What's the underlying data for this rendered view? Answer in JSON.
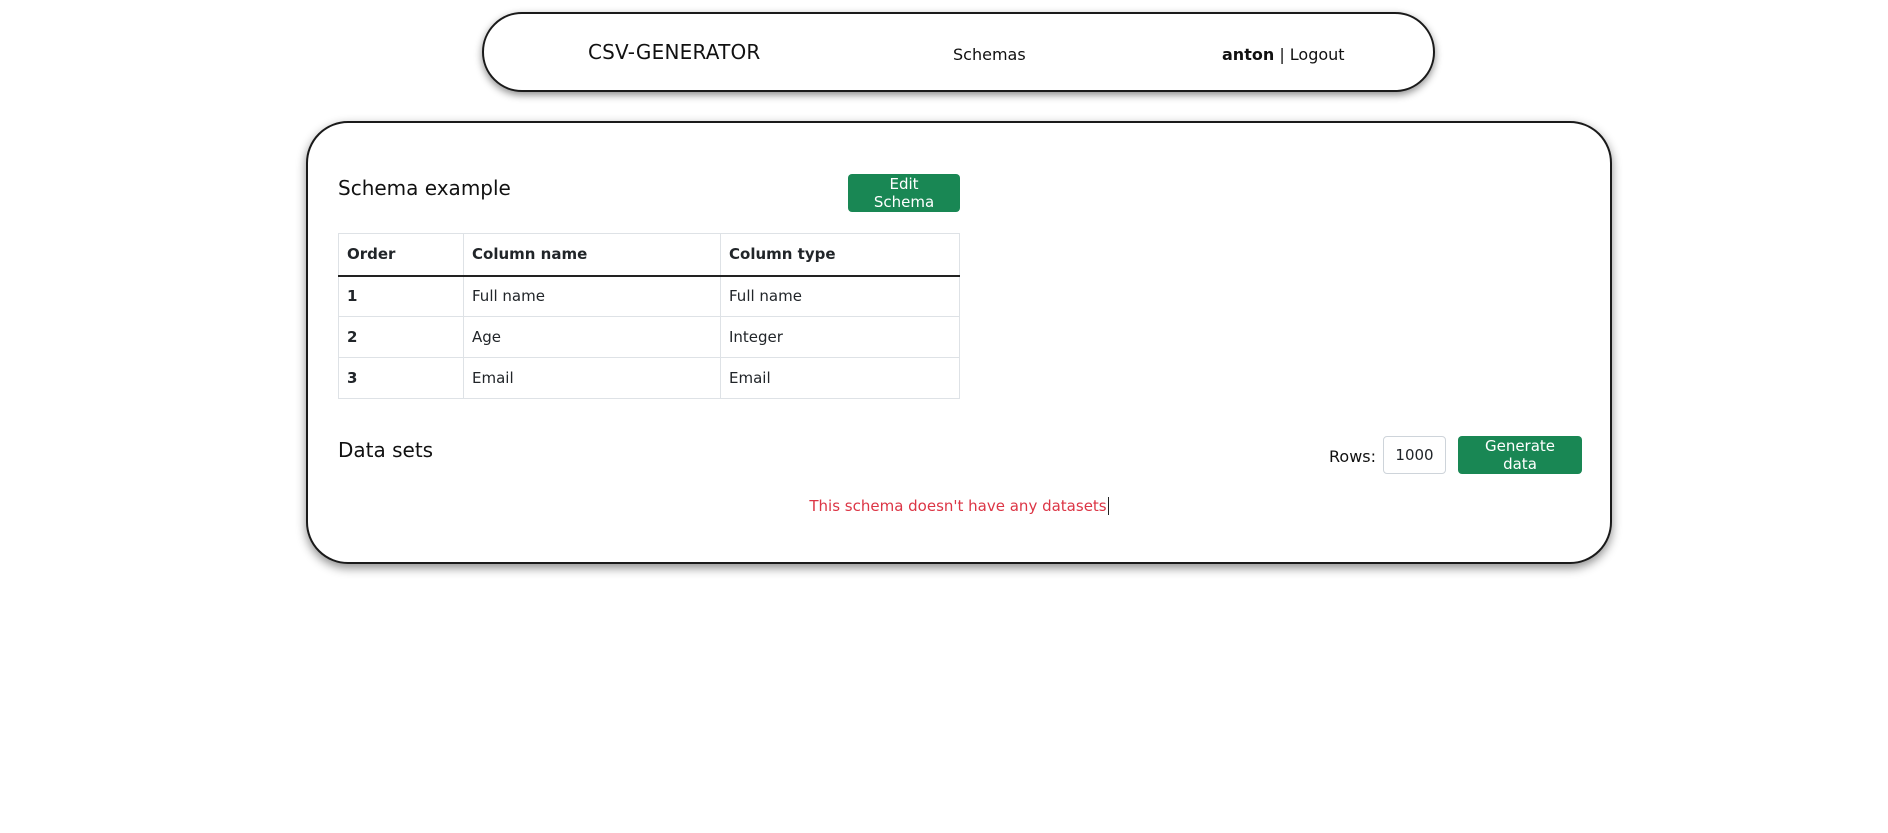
{
  "header": {
    "brand": "CSV-GENERATOR",
    "nav_link": "Schemas",
    "username": "anton",
    "separator": "|",
    "logout": "Logout"
  },
  "schema": {
    "title": "Schema example",
    "edit_button": "Edit Schema",
    "table": {
      "headers": [
        "Order",
        "Column name",
        "Column type"
      ],
      "rows": [
        {
          "order": "1",
          "name": "Full name",
          "type": "Full name"
        },
        {
          "order": "2",
          "name": "Age",
          "type": "Integer"
        },
        {
          "order": "3",
          "name": "Email",
          "type": "Email"
        }
      ]
    }
  },
  "datasets": {
    "title": "Data sets",
    "rows_label": "Rows:",
    "rows_value": "1000",
    "generate_button": "Generate data",
    "empty_message": "This schema doesn't have any datasets"
  },
  "colors": {
    "accent": "#198754",
    "error": "#dc3545"
  }
}
